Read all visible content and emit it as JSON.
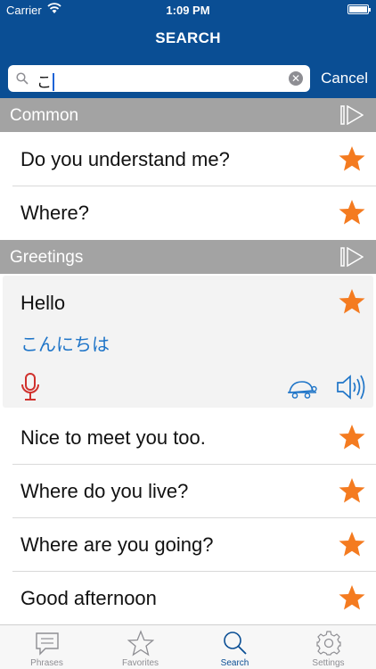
{
  "status": {
    "carrier": "Carrier",
    "time": "1:09 PM"
  },
  "nav": {
    "title": "SEARCH"
  },
  "search": {
    "query": "こ",
    "cancel": "Cancel"
  },
  "sections": [
    {
      "name": "Common",
      "rows": [
        "Do you understand me?",
        "Where?"
      ]
    },
    {
      "name": "Greetings",
      "expanded": {
        "phrase": "Hello",
        "translation": "こんにちは"
      },
      "rows": [
        "Nice to meet you too.",
        "Where do you live?",
        "Where are you going?",
        "Good afternoon"
      ]
    }
  ],
  "tabs": [
    {
      "label": "Phrases",
      "icon": "speech-bubble-icon"
    },
    {
      "label": "Favorites",
      "icon": "star-outline-icon"
    },
    {
      "label": "Search",
      "icon": "search-icon",
      "active": true
    },
    {
      "label": "Settings",
      "icon": "gear-icon"
    }
  ],
  "colors": {
    "nav": "#0a4e94",
    "section": "#a3a3a3",
    "star": "#f47b20",
    "translation": "#1f75c8",
    "mic": "#d0312d"
  }
}
